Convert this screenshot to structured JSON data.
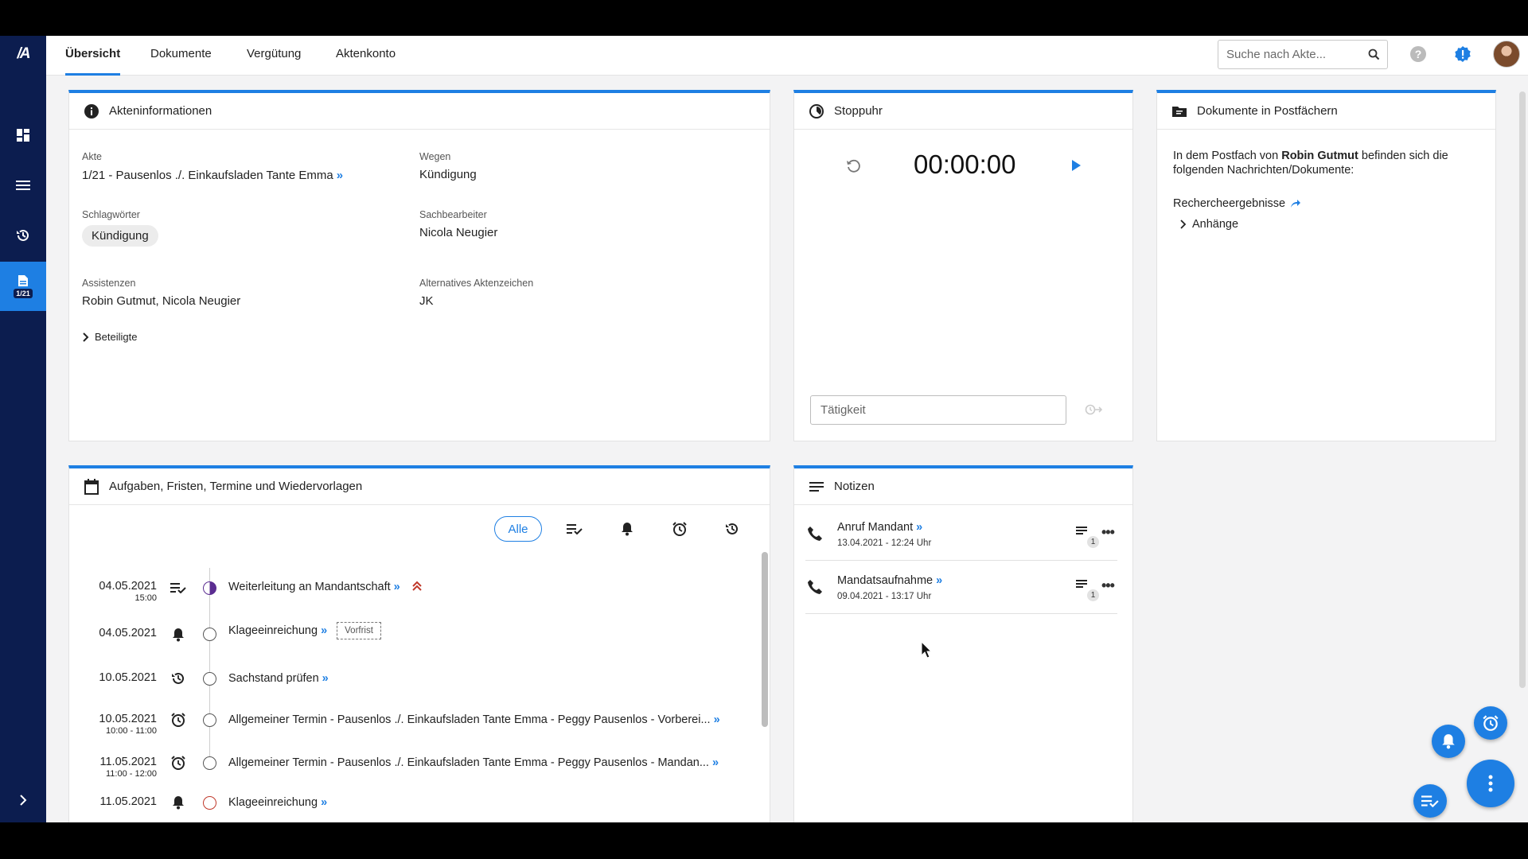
{
  "app": {
    "logo_text": "/A",
    "sidebar": {
      "active_file_badge": "1/21"
    }
  },
  "tabs": [
    "Übersicht",
    "Dokumente",
    "Vergütung",
    "Aktenkonto"
  ],
  "search": {
    "placeholder": "Suche nach Akte..."
  },
  "akteninfo": {
    "title": "Akteninformationen",
    "akte_label": "Akte",
    "akte_value": "1/21 - Pausenlos ./. Einkaufsladen Tante Emma",
    "wegen_label": "Wegen",
    "wegen_value": "Kündigung",
    "schlagwoerter_label": "Schlagwörter",
    "schlagwort_chip": "Kündigung",
    "sachbearbeiter_label": "Sachbearbeiter",
    "sachbearbeiter_value": "Nicola Neugier",
    "assistenzen_label": "Assistenzen",
    "assistenzen_value": "Robin Gutmut, Nicola Neugier",
    "alt_az_label": "Alternatives Aktenzeichen",
    "alt_az_value": "JK",
    "beteiligte_label": "Beteiligte"
  },
  "stoppuhr": {
    "title": "Stoppuhr",
    "time": "00:00:00",
    "task_placeholder": "Tätigkeit"
  },
  "dokumente": {
    "title": "Dokumente in Postfächern",
    "text_prefix": "In dem Postfach von ",
    "text_name": "Robin Gutmut",
    "text_suffix": " befinden sich die folgenden Nachrichten/Dokumente:",
    "item": "Rechercheergebnisse",
    "attachments": "Anhänge"
  },
  "tasks": {
    "title": "Aufgaben, Fristen, Termine und Wiedervorlagen",
    "filter_all": "Alle",
    "vorfrist": "Vorfrist",
    "rows": [
      {
        "date": "04.05.2021",
        "time": "15:00",
        "type": "task",
        "status": "half",
        "title": "Weiterleitung an Mandantschaft",
        "priority": true
      },
      {
        "date": "04.05.2021",
        "time": "",
        "type": "deadline",
        "status": "open",
        "title": "Klageeinreichung",
        "vorfrist": true
      },
      {
        "date": "10.05.2021",
        "time": "",
        "type": "resubmission",
        "status": "open",
        "title": "Sachstand prüfen"
      },
      {
        "date": "10.05.2021",
        "time": "10:00 - 11:00",
        "type": "appointment",
        "status": "open",
        "title": "Allgemeiner Termin - Pausenlos ./. Einkaufsladen Tante Emma - Peggy Pausenlos - Vorberei..."
      },
      {
        "date": "11.05.2021",
        "time": "11:00 - 12:00",
        "type": "appointment",
        "status": "open",
        "title": "Allgemeiner Termin - Pausenlos ./. Einkaufsladen Tante Emma - Peggy Pausenlos - Mandan..."
      },
      {
        "date": "11.05.2021",
        "time": "",
        "type": "deadline",
        "status": "open",
        "title": "Klageeinreichung"
      }
    ]
  },
  "notizen": {
    "title": "Notizen",
    "items": [
      {
        "title": "Anruf Mandant",
        "date": "13.04.2021 - 12:24 Uhr",
        "count": "1"
      },
      {
        "title": "Mandatsaufnahme",
        "date": "09.04.2021 - 13:17 Uhr",
        "count": "1"
      }
    ]
  },
  "colors": {
    "accent": "#1e7fe3",
    "sidebar": "#0c1d4f",
    "priority": "#c0392b",
    "status_half": "#5b2d91"
  }
}
